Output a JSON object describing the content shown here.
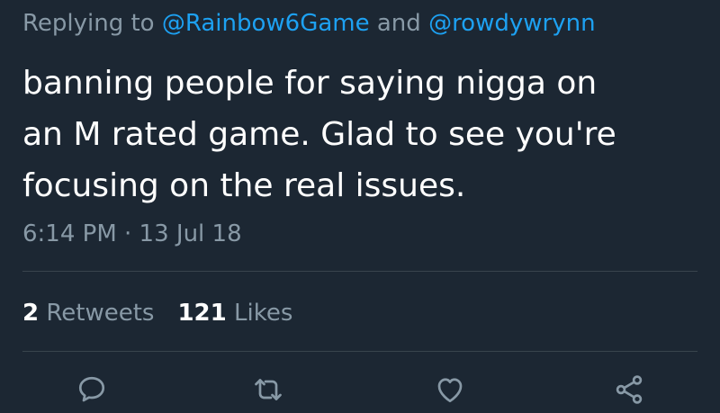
{
  "reply_context": {
    "prefix": "Replying to",
    "mention_1": "@Rainbow6Game",
    "conjunction": "and",
    "mention_2": "@rowdywrynn"
  },
  "tweet": {
    "text_lines": [
      "banning people for saying nigga on",
      "an M rated game. Glad to see you're",
      "focusing on the real issues."
    ],
    "timestamp": "6:14 PM · 13 Jul 18"
  },
  "stats": {
    "retweets_count": "2",
    "retweets_label": "Retweets",
    "likes_count": "121",
    "likes_label": "Likes"
  },
  "actions": [
    "reply-icon",
    "retweet-icon",
    "like-icon",
    "share-icon"
  ],
  "colors": {
    "background": "#1c2733",
    "text": "#ffffff",
    "muted": "#8899a6",
    "accent": "#1da1f2",
    "divider": "#38444d"
  }
}
